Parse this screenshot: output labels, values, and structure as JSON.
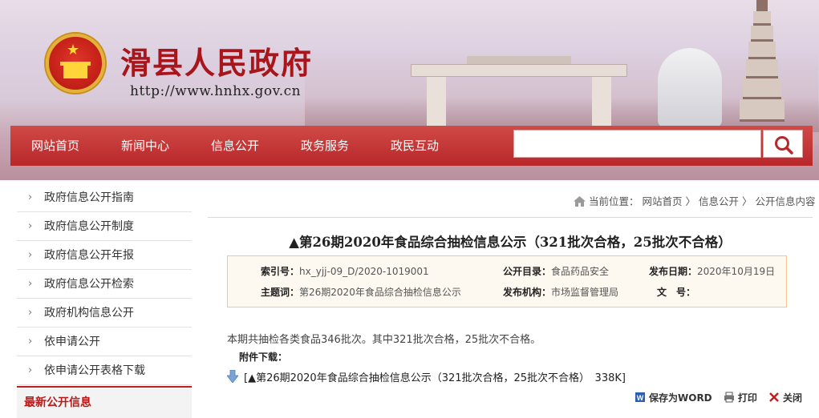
{
  "header": {
    "site_title": "滑县人民政府",
    "site_url": "http://www.hnhx.gov.cn",
    "brand_color": "#b8272a"
  },
  "nav": {
    "items": [
      "网站首页",
      "新闻中心",
      "信息公开",
      "政务服务",
      "政民互动"
    ],
    "search_placeholder": ""
  },
  "sidebar": {
    "items": [
      "政府信息公开指南",
      "政府信息公开制度",
      "政府信息公开年报",
      "政府信息公开检索",
      "政府机构信息公开",
      "依申请公开",
      "依申请公开表格下载"
    ],
    "latest_heading": "最新公开信息"
  },
  "breadcrumb": {
    "prefix": "当前位置：",
    "items": [
      "网站首页",
      "信息公开",
      "公开信息内容"
    ],
    "separator": "〉"
  },
  "article": {
    "title": "▲第26期2020年食品综合抽检信息公示（321批次合格，25批次不合格）",
    "meta": {
      "index_label": "索引号：",
      "index_value": "hx_yjj-09_D/2020-1019001",
      "catalog_label": "公开目录：",
      "catalog_value": "食品药品安全",
      "date_label": "发布日期：",
      "date_value": "2020年10月19日",
      "subject_label": "主题词：",
      "subject_value": "第26期2020年食品综合抽检信息公示",
      "org_label": "发布机构：",
      "org_value": "市场监督管理局",
      "docno_label": "文　号：",
      "docno_value": ""
    },
    "summary": "本期共抽检各类食品346批次。其中321批次合格，25批次不合格。",
    "attachments_label": "附件下载：",
    "attachment": "[▲第26期2020年食品综合抽检信息公示（321批次合格，25批次不合格）　338K]"
  },
  "actions": {
    "save_word": "保存为WORD",
    "print": "打印",
    "close": "关闭"
  }
}
